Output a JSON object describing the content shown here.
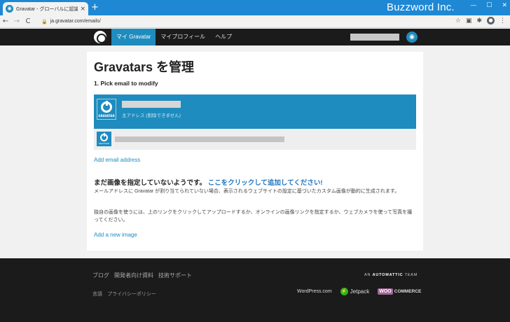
{
  "browser": {
    "tab_title": "Gravatar - グローバルに認識される!",
    "tab_close": "×",
    "new_tab": "+",
    "url": "ja.gravatar.com/emails/",
    "watermark": "Buzzword Inc.",
    "win_min": "—",
    "win_max": "☐",
    "win_close": "✕",
    "back": "←",
    "forward": "→",
    "reload": "C"
  },
  "site_nav": {
    "items": [
      {
        "label": "マイ Gravatar",
        "active": true
      },
      {
        "label": "マイプロフィール",
        "active": false
      },
      {
        "label": "ヘルプ",
        "active": false
      }
    ]
  },
  "main": {
    "title": "Gravatars を管理",
    "step_heading": "1. Pick email to modify",
    "primary_label": "GRAVATAR",
    "primary_note": "主アドレス (削除できません)",
    "secondary_label": "GRAVATAR",
    "add_email": "Add email address",
    "no_image_heading": "まだ画像を指定していないようです。",
    "no_image_link": "ここをクリックして追加してください!",
    "para1": "メールアドレスに Gravatar が割り当てられていない場合、表示されるウェブサイトの設定に基づいたカスタム画像が動的に生成されます。",
    "para2": "独自の画像を使うには、上のリンクをクリックしてアップロードするか、オンラインの画像リンクを指定するか、ウェブカメラを使って写真を撮ってください。",
    "add_image": "Add a new image"
  },
  "footer": {
    "links": [
      "ブログ",
      "開発者向け資料",
      "技術サポート"
    ],
    "links2": [
      "言語",
      "プライバシーポリシー"
    ],
    "automattic_prefix": "AN",
    "automattic_name": "AUTOMATTIC",
    "automattic_suffix": "TEAM",
    "wordpress": "WordPress.com",
    "jetpack": "Jetpack",
    "woo_badge": "WOO",
    "woo_text": "COMMERCE"
  }
}
